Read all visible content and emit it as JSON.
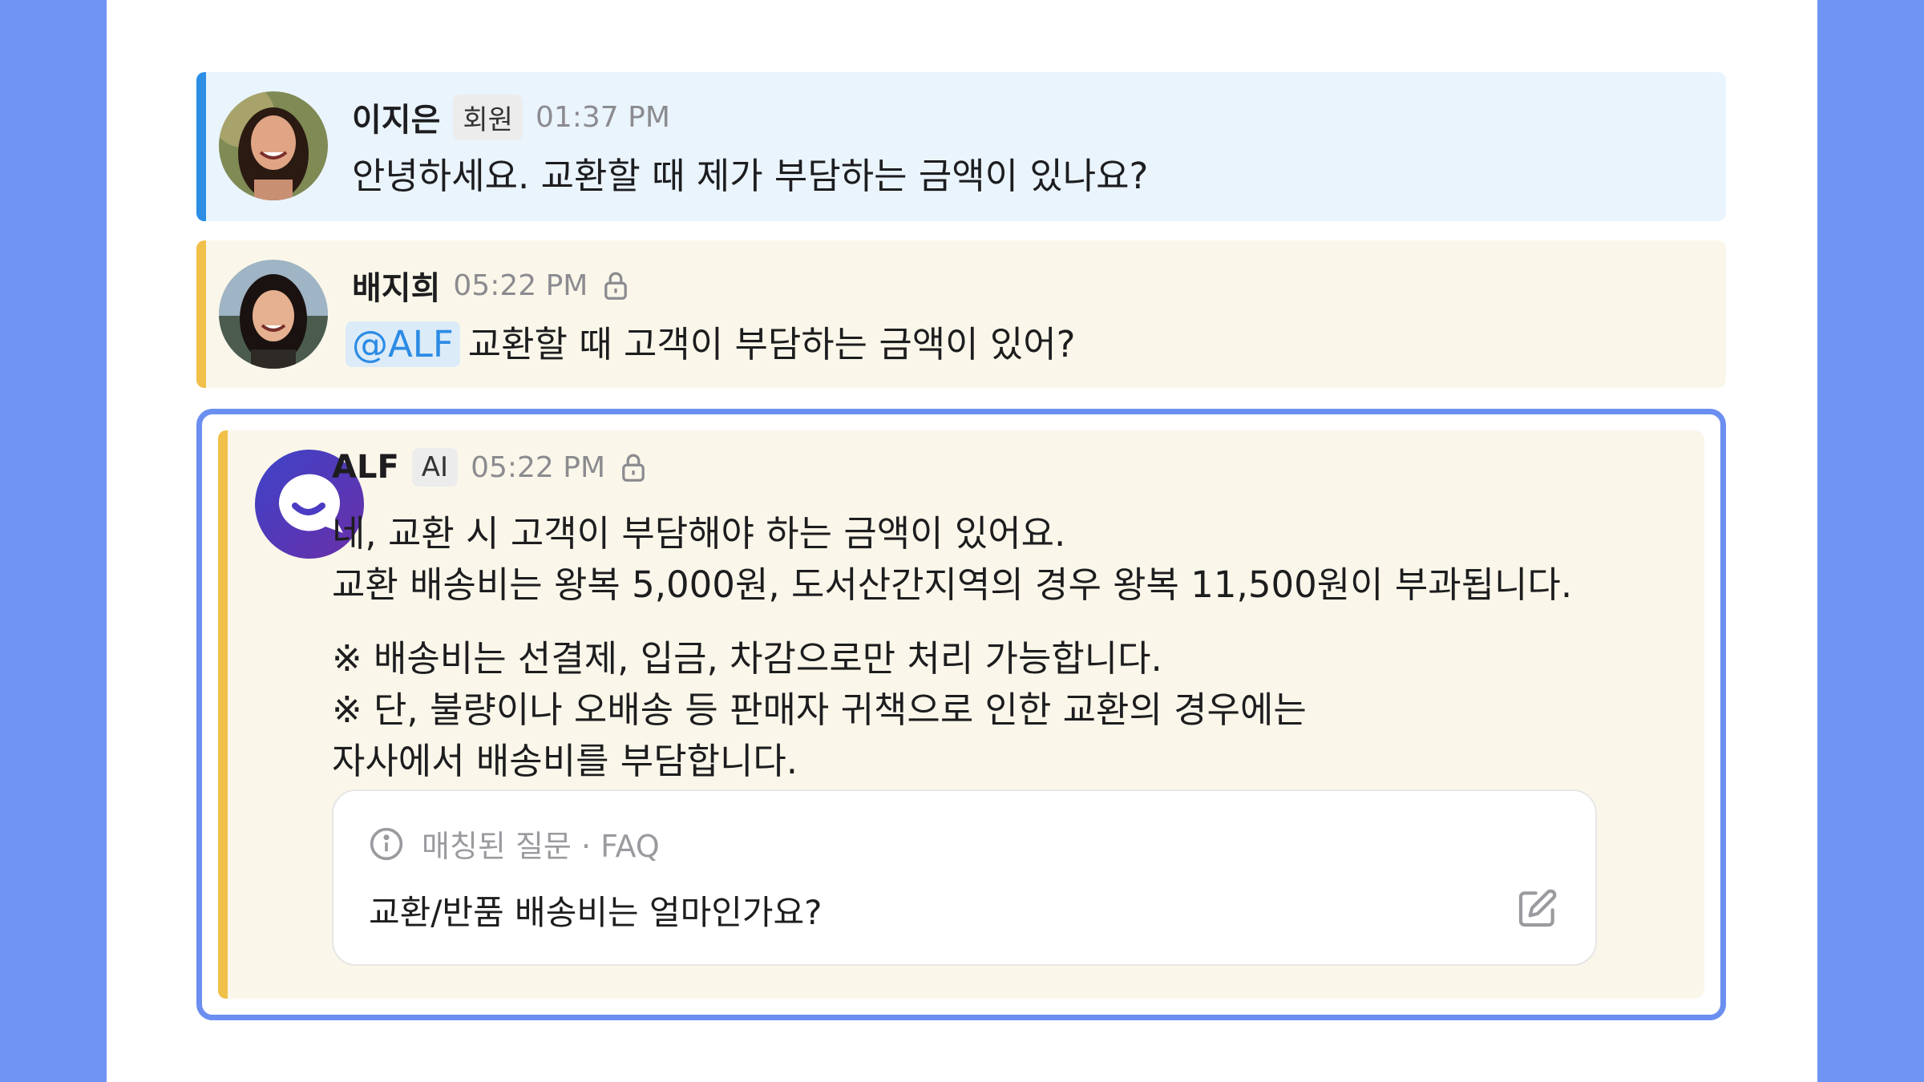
{
  "messages": [
    {
      "name": "이지은",
      "badge": "회원",
      "time": "01:37 PM",
      "text": "안녕하세요. 교환할 때 제가 부담하는 금액이 있나요?"
    },
    {
      "name": "배지희",
      "time": "05:22 PM",
      "mention": "@ALF",
      "text": "교환할 때 고객이 부담하는 금액이 있어?"
    }
  ],
  "alf": {
    "name": "ALF",
    "badge": "AI",
    "time": "05:22 PM",
    "lines": [
      "네, 교환 시 고객이 부담해야 하는 금액이 있어요.",
      "교환 배송비는 왕복 5,000원, 도서산간지역의 경우 왕복 11,500원이 부과됩니다.",
      "※ 배송비는 선결제, 입금, 차감으로만 처리 가능합니다.",
      "※ 단, 불량이나 오배송 등 판매자 귀책으로 인한 교환의 경우에는",
      "자사에서 배송비를 부담합니다."
    ],
    "faq": {
      "label": "매칭된 질문 · FAQ",
      "question": "교환/반품 배송비는 얼마인가요?"
    }
  },
  "colors": {
    "background": "#6f94f4",
    "customer_bar": "#2d8ee6",
    "agent_bar": "#f1c04a",
    "focus_border": "#6b8ff0",
    "mention": "#2b8be4"
  }
}
